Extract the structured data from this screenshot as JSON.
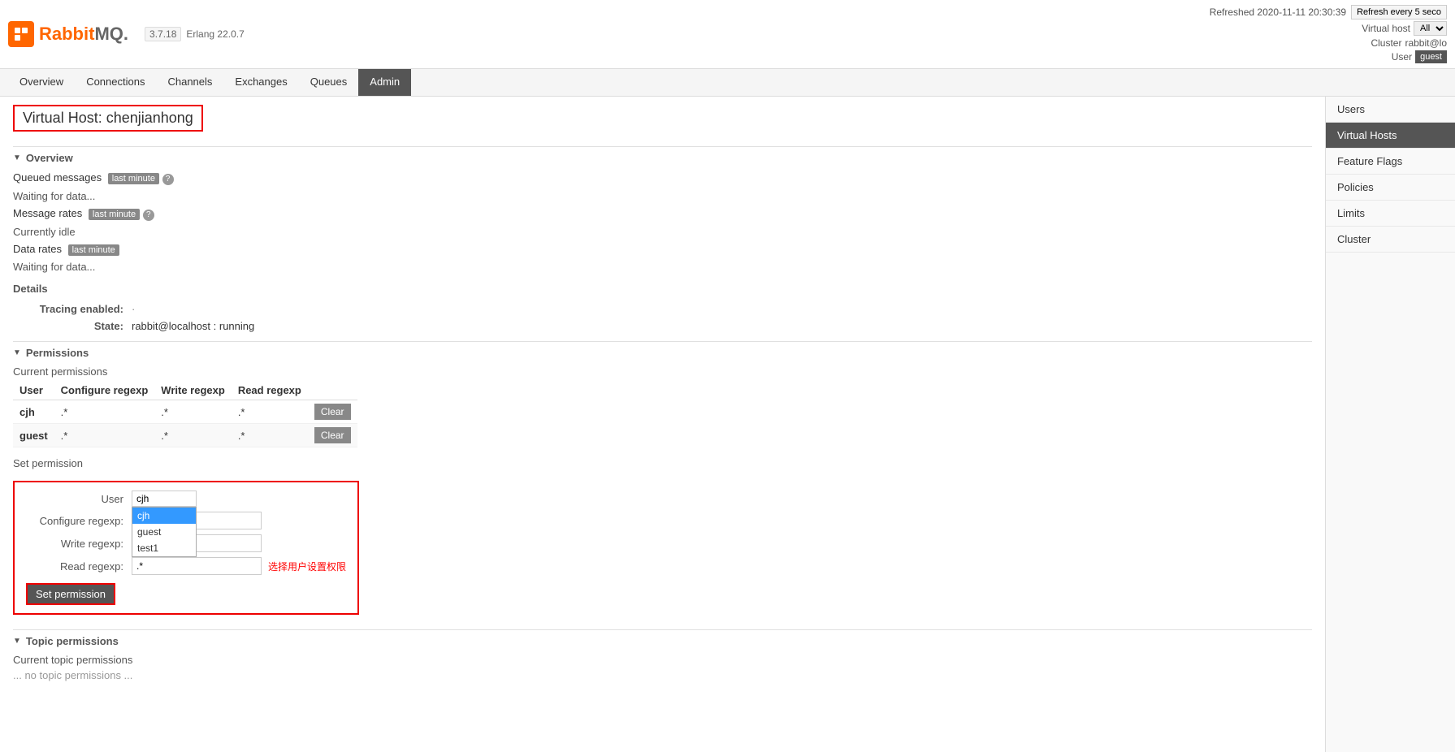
{
  "header": {
    "logo_text": "RabbitMQ",
    "version": "3.7.18",
    "erlang": "Erlang 22.0.7",
    "refresh_text": "Refreshed 2020-11-11 20:30:39",
    "refresh_btn": "Refresh every 5 seco",
    "vhost_label": "Virtual host",
    "vhost_value": "All",
    "cluster_label": "Cluster",
    "cluster_value": "rabbit@lo",
    "user_label": "User",
    "user_value": "guest"
  },
  "nav": {
    "items": [
      {
        "label": "Overview",
        "active": false
      },
      {
        "label": "Connections",
        "active": false
      },
      {
        "label": "Channels",
        "active": false
      },
      {
        "label": "Exchanges",
        "active": false
      },
      {
        "label": "Queues",
        "active": false
      },
      {
        "label": "Admin",
        "active": true
      }
    ]
  },
  "sidebar": {
    "items": [
      {
        "label": "Users",
        "active": false
      },
      {
        "label": "Virtual Hosts",
        "active": true
      },
      {
        "label": "Feature Flags",
        "active": false
      },
      {
        "label": "Policies",
        "active": false
      },
      {
        "label": "Limits",
        "active": false
      },
      {
        "label": "Cluster",
        "active": false
      }
    ]
  },
  "page": {
    "title": "Virtual Host: chenjianhong",
    "overview_section": "Overview",
    "queued_messages_label": "Queued messages",
    "queued_tag": "last minute",
    "waiting_data_1": "Waiting for data...",
    "message_rates_label": "Message rates",
    "message_rates_tag": "last minute",
    "currently_idle": "Currently idle",
    "data_rates_label": "Data rates",
    "data_rates_tag": "last minute",
    "waiting_data_2": "Waiting for data...",
    "details_section": "Details",
    "tracing_label": "Tracing enabled:",
    "tracing_value": "·",
    "state_label": "State:",
    "state_value": "rabbit@localhost : running",
    "permissions_section": "Permissions",
    "current_permissions_label": "Current permissions",
    "perm_table_headers": [
      "User",
      "Configure regexp",
      "Write regexp",
      "Read regexp",
      ""
    ],
    "perm_rows": [
      {
        "user": "cjh",
        "configure": ".*",
        "write": ".*",
        "read": ".*",
        "action": "Clear"
      },
      {
        "user": "guest",
        "configure": ".*",
        "write": ".*",
        "read": ".*",
        "action": "Clear"
      }
    ],
    "set_permission_label": "Set permission",
    "form_user_label": "User",
    "form_user_value": "cjh",
    "form_user_options": [
      "cjh",
      "guest",
      "test1"
    ],
    "form_configure_label": "Configure regexp:",
    "form_configure_value": "",
    "form_write_label": "Write regexp:",
    "form_write_value": "",
    "form_read_label": "Read regexp:",
    "form_read_value": ".*",
    "form_note": "选择用户设置权限",
    "set_perm_btn": "Set permission",
    "topic_permissions_section": "Topic permissions",
    "current_topic_permissions_label": "Current topic permissions",
    "no_topic_permissions": "... no topic permissions ..."
  }
}
